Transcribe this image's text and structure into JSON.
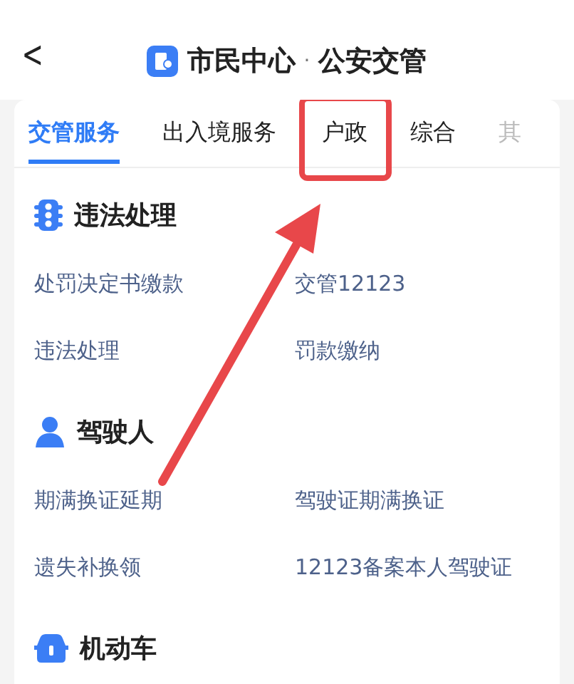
{
  "header": {
    "back": "<",
    "title": "市民中心",
    "separator": "·",
    "subtitle": "公安交管"
  },
  "tabs": [
    {
      "label": "交管服务",
      "selected": true,
      "highlighted": false
    },
    {
      "label": "出入境服务",
      "selected": false,
      "highlighted": false
    },
    {
      "label": "户政",
      "selected": false,
      "highlighted": true
    },
    {
      "label": "综合",
      "selected": false,
      "highlighted": false
    },
    {
      "label": "其",
      "selected": false,
      "highlighted": false
    }
  ],
  "sections": [
    {
      "kind": "traffic",
      "title": "违法处理",
      "items": [
        "处罚决定书缴款",
        "交管12123",
        "违法处理",
        "罚款缴纳"
      ]
    },
    {
      "kind": "driver",
      "title": "驾驶人",
      "items": [
        "期满换证延期",
        "驾驶证期满换证",
        "遗失补换领",
        "12123备案本人驾驶证"
      ]
    },
    {
      "kind": "vehicle",
      "title": "机动车"
    }
  ]
}
